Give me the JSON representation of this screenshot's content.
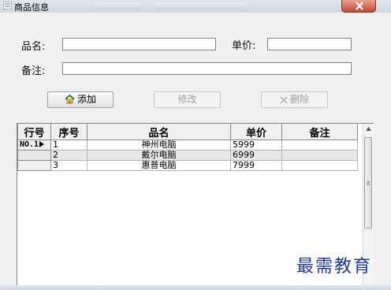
{
  "window": {
    "title": "商品信息",
    "colors": {
      "titlebar": "#cfd8e3",
      "close": "#c24a33",
      "watermark": "#1f3d8f"
    }
  },
  "form": {
    "name_label": "品名:",
    "price_label": "单价:",
    "note_label": "备注:",
    "name_value": "",
    "price_value": "",
    "note_value": ""
  },
  "buttons": {
    "add": {
      "label": "添加",
      "icon": "house-icon"
    },
    "edit": {
      "label": "修改"
    },
    "delete": {
      "label": "删除",
      "icon": "x-icon"
    }
  },
  "grid": {
    "headers": [
      "行号",
      "序号",
      "品名",
      "单价",
      "备注"
    ],
    "rows": [
      {
        "rowno": "NO.1",
        "seq": "1",
        "name": "神州电脑",
        "price": "5999",
        "note": ""
      },
      {
        "rowno": "",
        "seq": "2",
        "name": "戴尔电脑",
        "price": "6999",
        "note": ""
      },
      {
        "rowno": "",
        "seq": "3",
        "name": "惠普电脑",
        "price": "7999",
        "note": ""
      }
    ]
  },
  "watermark": "最需教育"
}
